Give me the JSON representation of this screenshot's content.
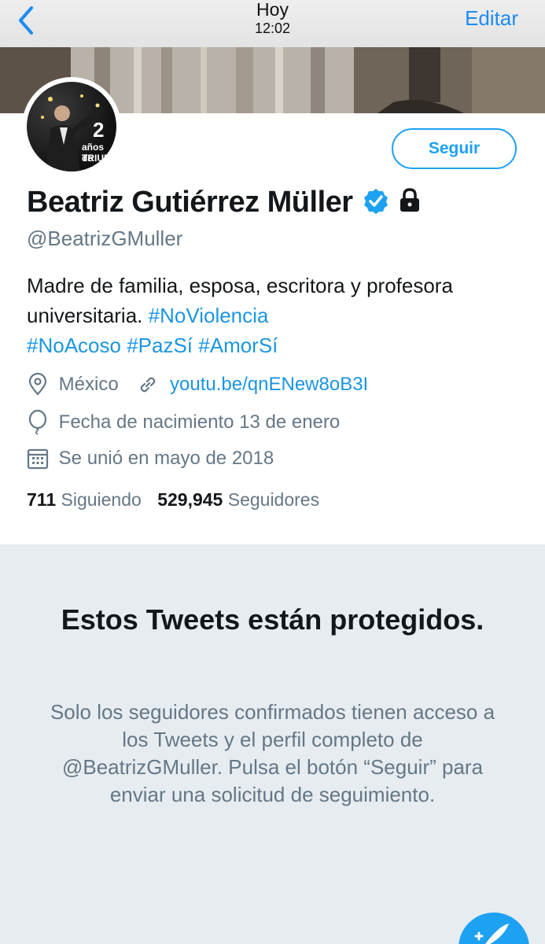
{
  "nav": {
    "title": "Hoy",
    "time": "12:02",
    "edit_label": "Editar",
    "back_icon": "chevron-left-icon"
  },
  "profile": {
    "avatar_number": "2",
    "avatar_text_1": "años de",
    "avatar_text_2": "TRIUNF",
    "follow_label": "Seguir",
    "name": "Beatriz Gutiérrez Müller",
    "verified_icon": "verified-badge-icon",
    "lock_icon": "lock-icon",
    "handle": "@BeatrizGMuller",
    "bio_text": "Madre de familia, esposa, escritora y profesora universitaria.",
    "hashtags": [
      "#NoViolencia",
      "#NoAcoso",
      "#PazSí",
      "#AmorSí"
    ],
    "location": "México",
    "link": "youtu.be/qnENew8oB3I",
    "birthday": "Fecha de nacimiento 13 de enero",
    "joined": "Se unió en mayo de 2018",
    "following_count": "711",
    "following_label": "Siguiendo",
    "followers_count": "529,945",
    "followers_label": "Seguidores"
  },
  "protected": {
    "title": "Estos Tweets están protegidos.",
    "description": "Solo los seguidores confirmados tienen acceso a los Tweets y el perfil completo de @BeatrizGMuller. Pulsa el botón “Seguir” para enviar una solicitud de seguimiento."
  },
  "colors": {
    "accent": "#1da1f2",
    "link": "#1b95e0",
    "secondary_text": "#657786",
    "protected_bg": "#e6ecf0"
  }
}
